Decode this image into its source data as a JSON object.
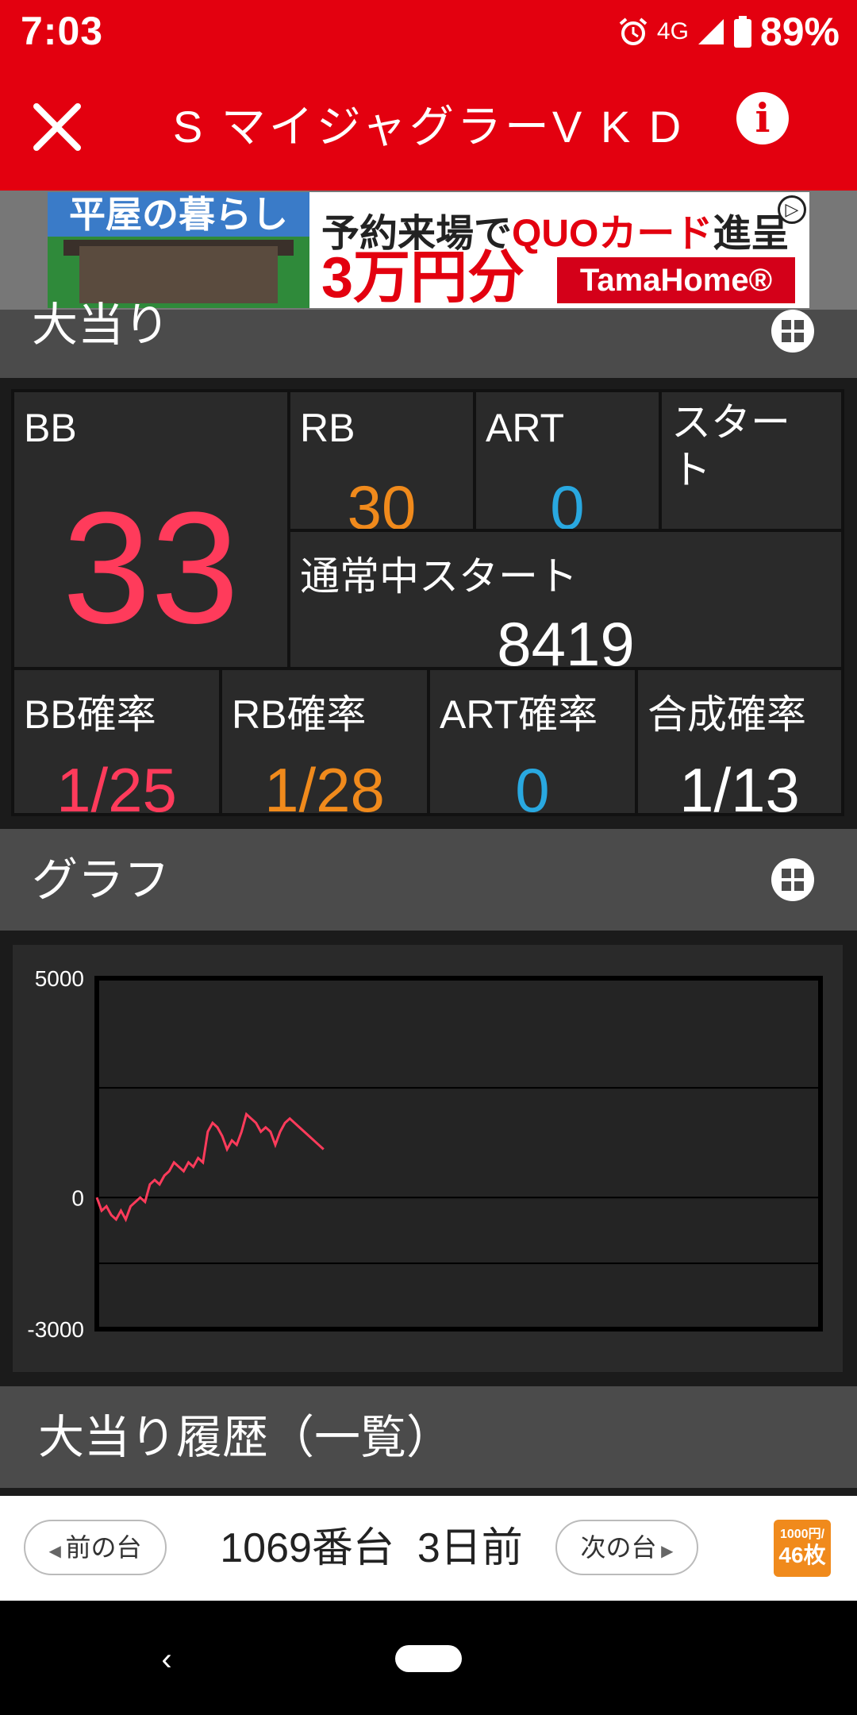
{
  "status_bar": {
    "time": "7:03",
    "network": "4G",
    "battery": "89%"
  },
  "header": {
    "title": "S マイジャグラーV K D",
    "close_icon": "close-icon",
    "info_icon": "info-icon"
  },
  "ad": {
    "left_title": "平屋の暮らし",
    "line1_prefix": "予約来場で",
    "line1_highlight": "QUOカード",
    "line1_suffix": "進呈",
    "line2": "3万円分",
    "brand": "TamaHome®"
  },
  "sections": {
    "jackpot": {
      "title": "大当り"
    },
    "graph": {
      "title": "グラフ"
    },
    "history": {
      "title": "大当り履歴（一覧）"
    }
  },
  "stats": {
    "bb_label": "BB",
    "bb_value": "33",
    "rb_label": "RB",
    "rb_value": "30",
    "art_label": "ART",
    "art_value": "0",
    "start_label": "スタート",
    "normal_start_label": "通常中スタート",
    "normal_start_value": "8419",
    "bb_prob_label": "BB確率",
    "bb_prob_value": "1/25",
    "rb_prob_label": "RB確率",
    "rb_prob_value": "1/28",
    "art_prob_label": "ART確率",
    "art_prob_value": "0",
    "combined_prob_label": "合成確率",
    "combined_prob_value": "1/13"
  },
  "colors": {
    "brand_red": "#e3000f",
    "bb": "#ff3b5b",
    "rb": "#f08a1c",
    "art": "#29a8e0",
    "graph_line": "#ff3b5b"
  },
  "chart_data": {
    "type": "line",
    "ylim": [
      -3000,
      5000
    ],
    "yticks": [
      5000,
      0,
      -3000
    ],
    "x": [
      0,
      1,
      2,
      3,
      4,
      5,
      6,
      7,
      8,
      9,
      10,
      11,
      12,
      13,
      14,
      15,
      16,
      17,
      18,
      19,
      20,
      21,
      22,
      23,
      24,
      25,
      26,
      27,
      28,
      29,
      30,
      31,
      32,
      33,
      34,
      35,
      36,
      37,
      38,
      39,
      40,
      41,
      42,
      43,
      44,
      45,
      46,
      47
    ],
    "series": [
      {
        "values": [
          0,
          -300,
          -200,
          -400,
          -500,
          -300,
          -500,
          -200,
          -100,
          0,
          -100,
          300,
          400,
          300,
          500,
          600,
          800,
          700,
          600,
          800,
          700,
          900,
          800,
          1500,
          1700,
          1600,
          1400,
          1100,
          1300,
          1200,
          1500,
          1900,
          1800,
          1700,
          1500,
          1600,
          1500,
          1200,
          1500,
          1700,
          1800,
          1700,
          1600,
          1500,
          1400,
          1300,
          1200,
          1100
        ]
      }
    ]
  },
  "bottom_nav": {
    "prev_label": "前の台",
    "next_label": "次の台",
    "machine_number": "1069番台",
    "days_ago": "3日前",
    "rate_top": "1000円/",
    "rate_value": "46枚"
  }
}
